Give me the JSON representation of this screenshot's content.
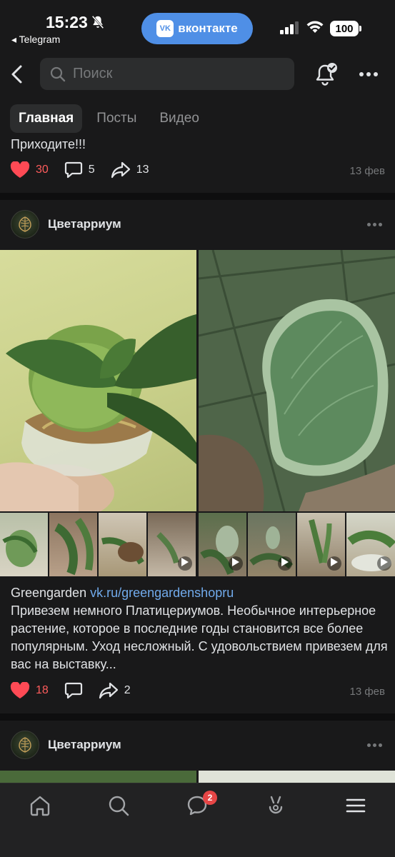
{
  "status": {
    "time": "15:23",
    "back_app": "◂ Telegram",
    "pill_label": "вконтакте",
    "pill_logo": "VK",
    "battery": "100"
  },
  "search": {
    "placeholder": "Поиск"
  },
  "tabs": [
    {
      "label": "Главная",
      "active": true
    },
    {
      "label": "Посты",
      "active": false
    },
    {
      "label": "Видео",
      "active": false
    }
  ],
  "post1": {
    "text": "Приходите!!!",
    "likes": "30",
    "comments": "5",
    "shares": "13",
    "date": "13 фев"
  },
  "post2": {
    "author": "Цветарриум",
    "link_author": "Greengarden",
    "link_url": "vk.ru/greengardenshopru",
    "text": "Привезем немного Платицериумов. Необычное интерьерное растение, которое в последние годы становится все более популярным. Уход несложный. С удовольствием привезем для вас на выставку...",
    "likes": "18",
    "shares": "2",
    "date": "13 фев"
  },
  "post3": {
    "author": "Цветарриум"
  },
  "tabbar": {
    "messages_badge": "2"
  },
  "colors": {
    "accent": "#4f8fe6",
    "like": "#ff5c5c",
    "link": "#71aaeb",
    "background": "#19191a"
  }
}
